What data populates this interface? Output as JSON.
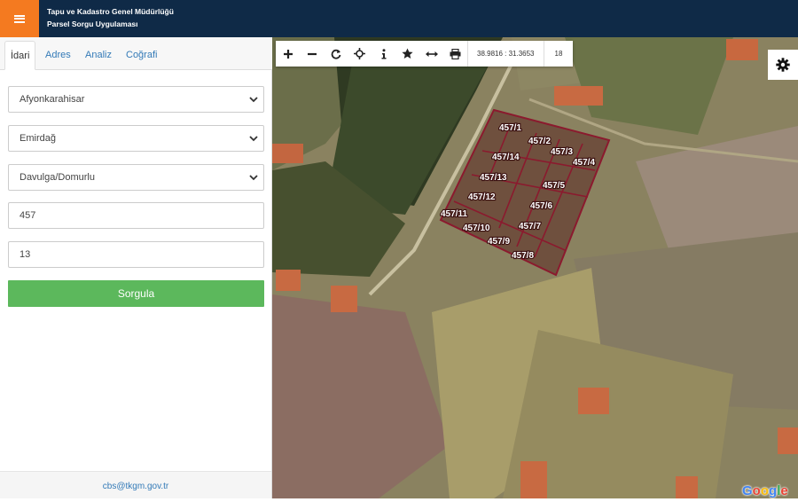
{
  "header": {
    "title_line1": "Tapu ve Kadastro Genel Müdürlüğü",
    "title_line2": "Parsel Sorgu Uygulaması"
  },
  "tabs": [
    {
      "label": "İdari"
    },
    {
      "label": "Adres"
    },
    {
      "label": "Analiz"
    },
    {
      "label": "Coğrafi"
    }
  ],
  "form": {
    "il": "Afyonkarahisar",
    "ilce": "Emirdağ",
    "mahalle": "Davulga/Domurlu",
    "ada": "457",
    "parsel": "13",
    "submit_label": "Sorgula"
  },
  "footer": {
    "email": "cbs@tkgm.gov.tr"
  },
  "map": {
    "coordinates": "38.9816 : 31.3653",
    "zoom": "18",
    "google_letters": [
      "G",
      "o",
      "o",
      "g",
      "l",
      "e"
    ],
    "google_colors": [
      "#4285f4",
      "#ea4335",
      "#fbbc05",
      "#4285f4",
      "#34a853",
      "#ea4335"
    ],
    "parcel_border_color": "#8b1a2e",
    "parcels": [
      "457/1",
      "457/2",
      "457/3",
      "457/4",
      "457/14",
      "457/13",
      "457/5",
      "457/12",
      "457/6",
      "457/11",
      "457/10",
      "457/7",
      "457/9",
      "457/8"
    ]
  },
  "icons": [
    "menu-icon",
    "zoom-in-icon",
    "zoom-out-icon",
    "refresh-icon",
    "locate-icon",
    "info-icon",
    "star-icon",
    "measure-icon",
    "print-icon",
    "gear-icon",
    "chevron-down-icon"
  ]
}
